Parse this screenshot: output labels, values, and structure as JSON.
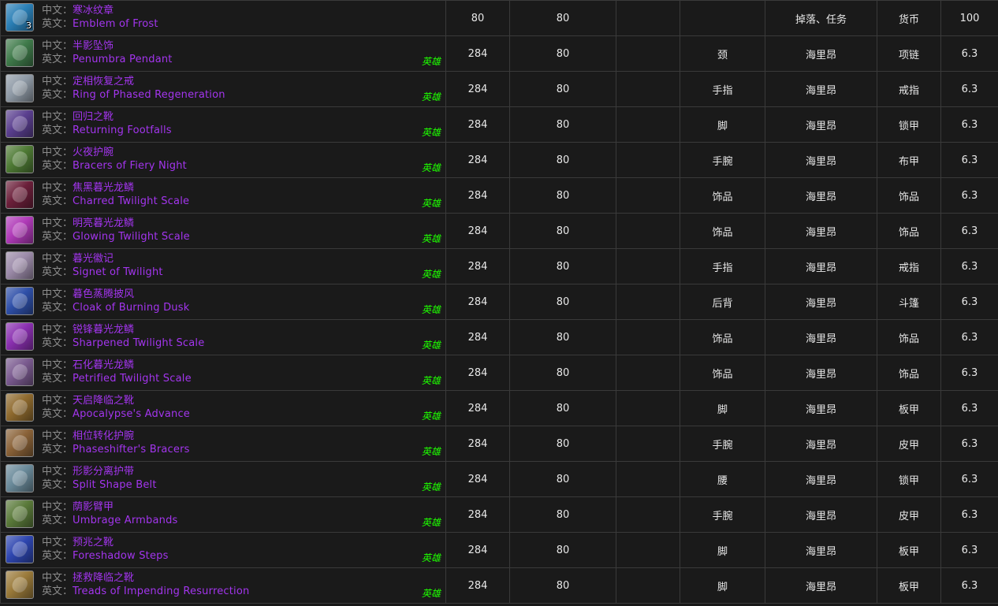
{
  "labels": {
    "cn": "中文：",
    "en": "英文："
  },
  "rows": [
    {
      "icon": "emblem-of-frost-icon",
      "icon_color": "#2a7fb6",
      "stack": "3",
      "cn": "寒冰纹章",
      "en": "Emblem of Frost",
      "heroic": "",
      "ilvl": "80",
      "req": "80",
      "col4": "",
      "slot": "",
      "source": "掉落、任务",
      "type": "货币",
      "ver": "100"
    },
    {
      "icon": "penumbra-pendant-icon",
      "icon_color": "#3f7a4a",
      "cn": "半影坠饰",
      "en": "Penumbra Pendant",
      "heroic": "英雄",
      "ilvl": "284",
      "req": "80",
      "col4": "",
      "slot": "颈",
      "source": "海里昂",
      "type": "项链",
      "ver": "6.3"
    },
    {
      "icon": "ring-of-phased-regeneration-icon",
      "icon_color": "#8f9aa6",
      "cn": "定相恢复之戒",
      "en": "Ring of Phased Regeneration",
      "heroic": "英雄",
      "ilvl": "284",
      "req": "80",
      "col4": "",
      "slot": "手指",
      "source": "海里昂",
      "type": "戒指",
      "ver": "6.3"
    },
    {
      "icon": "returning-footfalls-icon",
      "icon_color": "#5a3f8f",
      "cn": "回归之靴",
      "en": "Returning Footfalls",
      "heroic": "英雄",
      "ilvl": "284",
      "req": "80",
      "col4": "",
      "slot": "脚",
      "source": "海里昂",
      "type": "锁甲",
      "ver": "6.3"
    },
    {
      "icon": "bracers-of-fiery-night-icon",
      "icon_color": "#4e7a34",
      "cn": "火夜护腕",
      "en": "Bracers of Fiery Night",
      "heroic": "英雄",
      "ilvl": "284",
      "req": "80",
      "col4": "",
      "slot": "手腕",
      "source": "海里昂",
      "type": "布甲",
      "ver": "6.3"
    },
    {
      "icon": "charred-twilight-scale-icon",
      "icon_color": "#6b1f3a",
      "cn": "焦黑暮光龙鳞",
      "en": "Charred Twilight Scale",
      "heroic": "英雄",
      "ilvl": "284",
      "req": "80",
      "col4": "",
      "slot": "饰品",
      "source": "海里昂",
      "type": "饰品",
      "ver": "6.3"
    },
    {
      "icon": "glowing-twilight-scale-icon",
      "icon_color": "#b03ab8",
      "cn": "明亮暮光龙鳞",
      "en": "Glowing Twilight Scale",
      "heroic": "英雄",
      "ilvl": "284",
      "req": "80",
      "col4": "",
      "slot": "饰品",
      "source": "海里昂",
      "type": "饰品",
      "ver": "6.3"
    },
    {
      "icon": "signet-of-twilight-icon",
      "icon_color": "#9b8aa8",
      "cn": "暮光徽记",
      "en": "Signet of Twilight",
      "heroic": "英雄",
      "ilvl": "284",
      "req": "80",
      "col4": "",
      "slot": "手指",
      "source": "海里昂",
      "type": "戒指",
      "ver": "6.3"
    },
    {
      "icon": "cloak-of-burning-dusk-icon",
      "icon_color": "#2e4fa8",
      "cn": "暮色蒸腾披风",
      "en": "Cloak of Burning Dusk",
      "heroic": "英雄",
      "ilvl": "284",
      "req": "80",
      "col4": "",
      "slot": "后背",
      "source": "海里昂",
      "type": "斗篷",
      "ver": "6.3"
    },
    {
      "icon": "sharpened-twilight-scale-icon",
      "icon_color": "#8a2fb0",
      "cn": "锐锋暮光龙鳞",
      "en": "Sharpened Twilight Scale",
      "heroic": "英雄",
      "ilvl": "284",
      "req": "80",
      "col4": "",
      "slot": "饰品",
      "source": "海里昂",
      "type": "饰品",
      "ver": "6.3"
    },
    {
      "icon": "petrified-twilight-scale-icon",
      "icon_color": "#7a5a8f",
      "cn": "石化暮光龙鳞",
      "en": "Petrified Twilight Scale",
      "heroic": "英雄",
      "ilvl": "284",
      "req": "80",
      "col4": "",
      "slot": "饰品",
      "source": "海里昂",
      "type": "饰品",
      "ver": "6.3"
    },
    {
      "icon": "apocalypses-advance-icon",
      "icon_color": "#8f6a2e",
      "cn": "天启降临之靴",
      "en": "Apocalypse's Advance",
      "heroic": "英雄",
      "ilvl": "284",
      "req": "80",
      "col4": "",
      "slot": "脚",
      "source": "海里昂",
      "type": "板甲",
      "ver": "6.3"
    },
    {
      "icon": "phaseshifters-bracers-icon",
      "icon_color": "#8a6238",
      "cn": "相位转化护腕",
      "en": "Phaseshifter's Bracers",
      "heroic": "英雄",
      "ilvl": "284",
      "req": "80",
      "col4": "",
      "slot": "手腕",
      "source": "海里昂",
      "type": "皮甲",
      "ver": "6.3"
    },
    {
      "icon": "split-shape-belt-icon",
      "icon_color": "#6a8a9a",
      "cn": "形影分离护带",
      "en": "Split Shape Belt",
      "heroic": "英雄",
      "ilvl": "284",
      "req": "80",
      "col4": "",
      "slot": "腰",
      "source": "海里昂",
      "type": "锁甲",
      "ver": "6.3"
    },
    {
      "icon": "umbrage-armbands-icon",
      "icon_color": "#5a7a3a",
      "cn": "荫影臂甲",
      "en": "Umbrage Armbands",
      "heroic": "英雄",
      "ilvl": "284",
      "req": "80",
      "col4": "",
      "slot": "手腕",
      "source": "海里昂",
      "type": "皮甲",
      "ver": "6.3"
    },
    {
      "icon": "foreshadow-steps-icon",
      "icon_color": "#2e46b0",
      "cn": "预兆之靴",
      "en": "Foreshadow Steps",
      "heroic": "英雄",
      "ilvl": "284",
      "req": "80",
      "col4": "",
      "slot": "脚",
      "source": "海里昂",
      "type": "板甲",
      "ver": "6.3"
    },
    {
      "icon": "treads-of-impending-resurrection-icon",
      "icon_color": "#9a7a3a",
      "cn": "拯救降临之靴",
      "en": "Treads of Impending Resurrection",
      "heroic": "英雄",
      "ilvl": "284",
      "req": "80",
      "col4": "",
      "slot": "脚",
      "source": "海里昂",
      "type": "板甲",
      "ver": "6.3"
    }
  ]
}
